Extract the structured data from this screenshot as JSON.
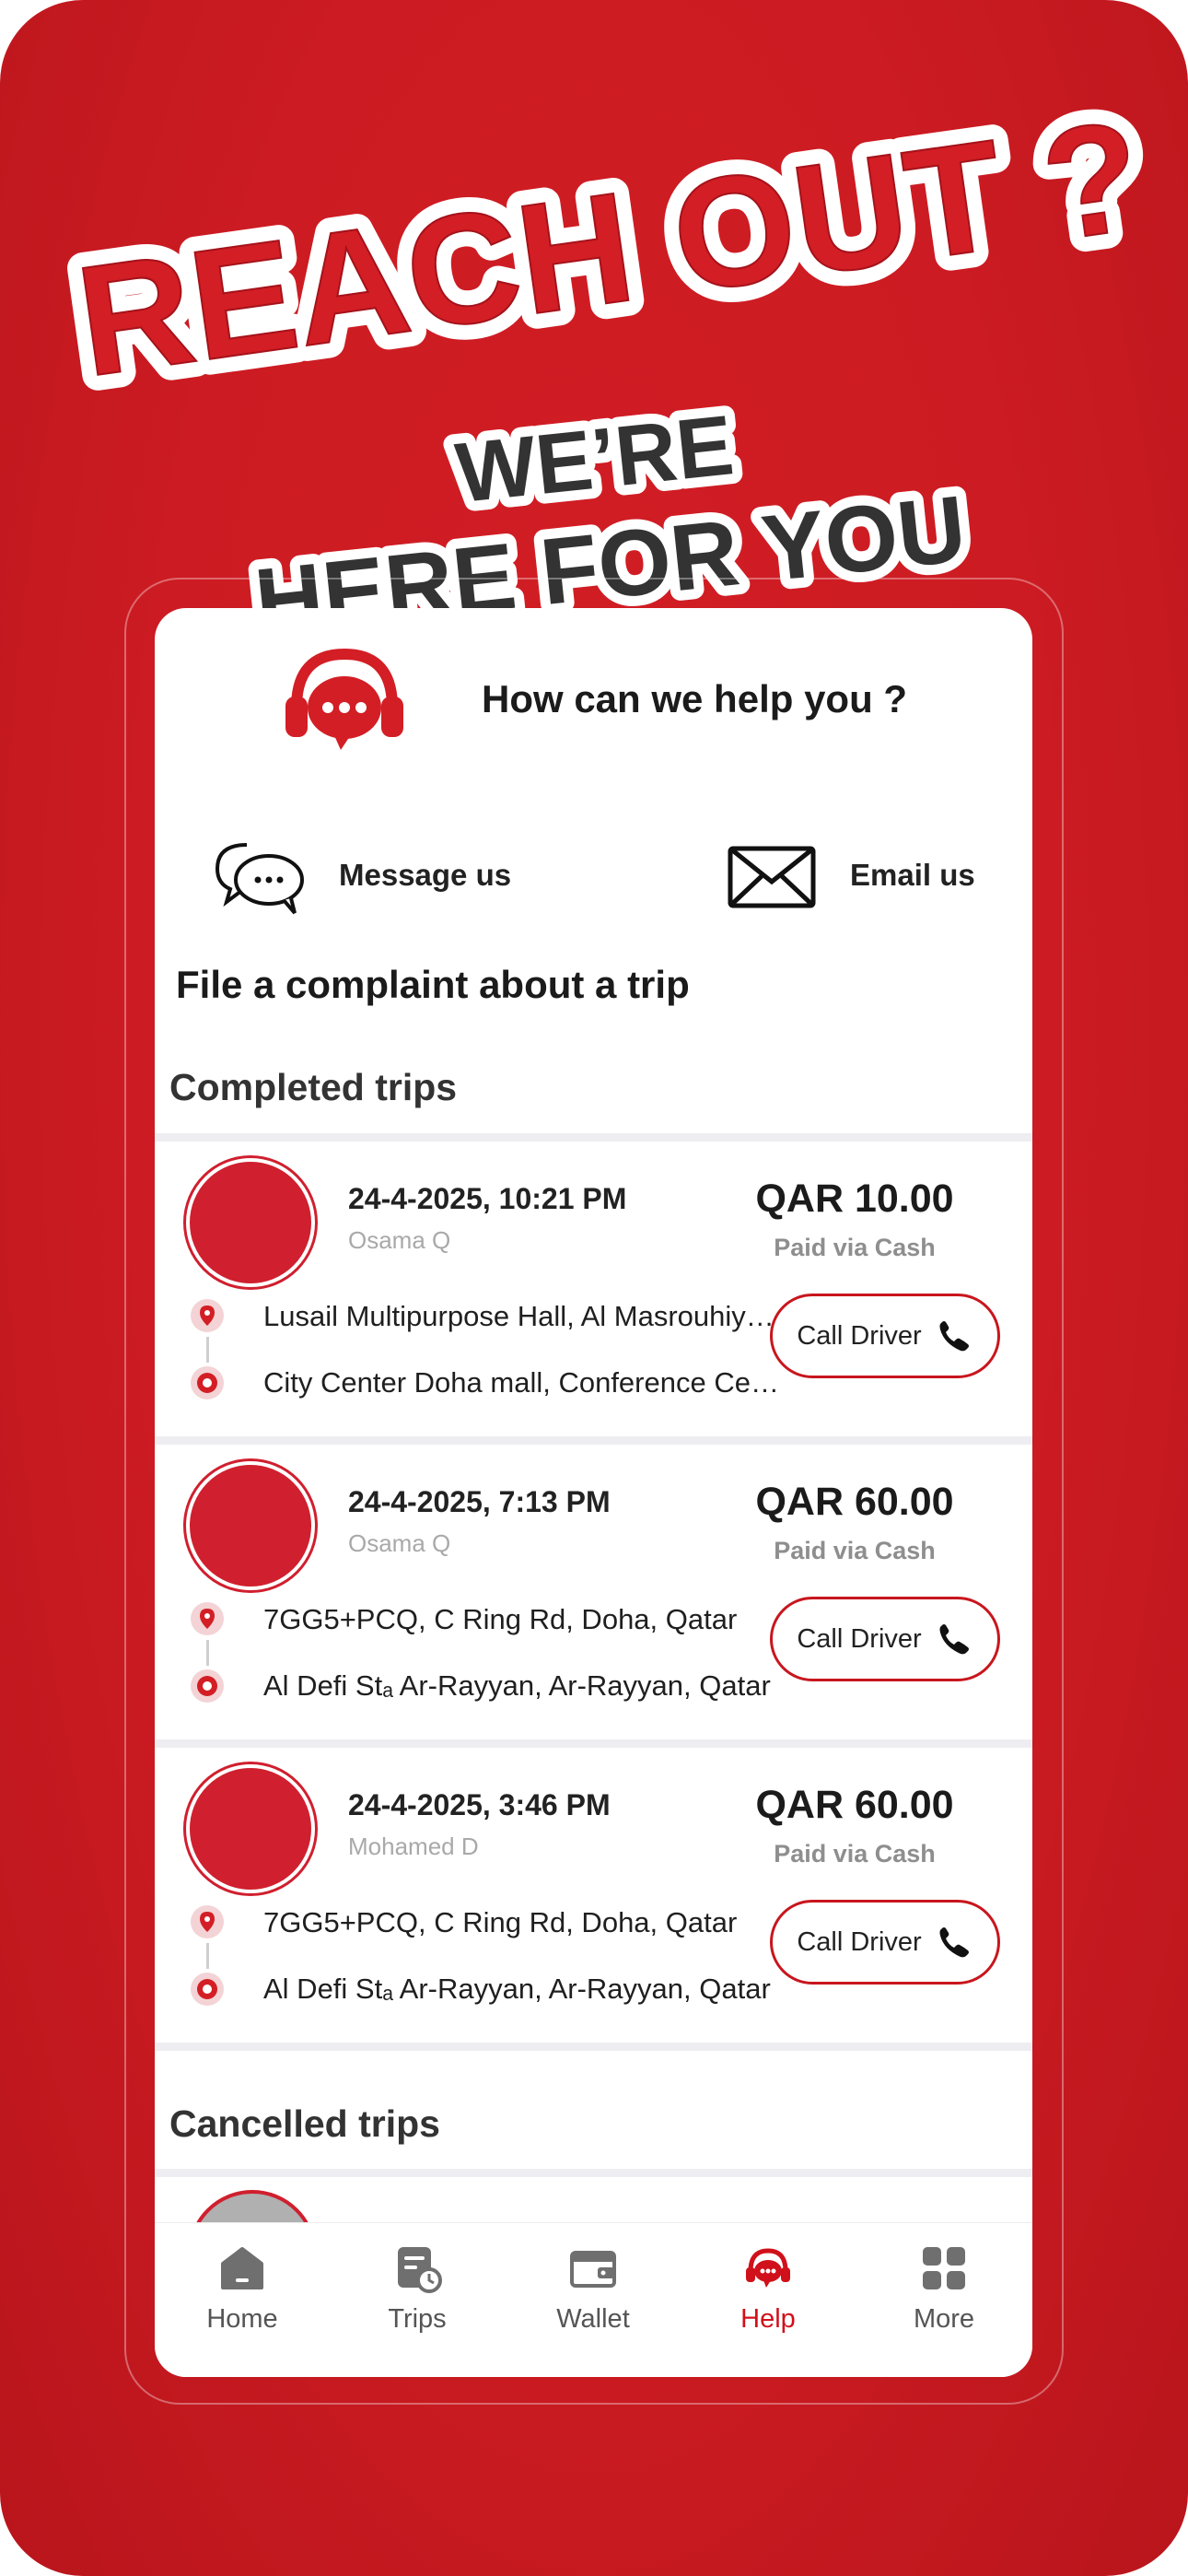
{
  "headline": {
    "line1": "REACH OUT ?",
    "line2": "WE’RE",
    "line3": "HERE FOR YOU"
  },
  "help": {
    "title": "How can we help you ?",
    "icon": "headset-chat-icon"
  },
  "contact": {
    "message_label": "Message us",
    "message_icon": "chat-bubbles-icon",
    "email_label": "Email us",
    "email_icon": "envelope-icon"
  },
  "complaint_title": "File a complaint about a trip",
  "sections": {
    "completed": "Completed trips",
    "cancelled": "Cancelled trips"
  },
  "trips": [
    {
      "date": "24-4-2025, 10:21 PM",
      "driver": "Osama Q",
      "price": "QAR 10.00",
      "paid": "Paid via Cash",
      "from": "Lusail Multipurpose Hall, Al Masrouhiya, Lusail, Qatar",
      "to": "City Center Doha mall, Conference Centre St, Doha, Qatar",
      "button": "Call Driver"
    },
    {
      "date": "24-4-2025, 7:13 PM",
      "driver": "Osama Q",
      "price": "QAR 60.00",
      "paid": "Paid via Cash",
      "from": "7GG5+PCQ, C Ring Rd, Doha, Qatar",
      "to": "Al Defi Stₐ Ar-Rayyan, Ar-Rayyan, Qatar",
      "button": "Call Driver"
    },
    {
      "date": "24-4-2025, 3:46 PM",
      "driver": "Mohamed D",
      "price": "QAR 60.00",
      "paid": "Paid via Cash",
      "from": "7GG5+PCQ, C Ring Rd, Doha, Qatar",
      "to": "Al Defi Stₐ Ar-Rayyan, Ar-Rayyan, Qatar",
      "button": "Call Driver"
    }
  ],
  "tabs": [
    {
      "label": "Home",
      "icon": "home-icon"
    },
    {
      "label": "Trips",
      "icon": "trips-clock-icon"
    },
    {
      "label": "Wallet",
      "icon": "wallet-icon"
    },
    {
      "label": "Help",
      "icon": "help-headset-icon",
      "active": true
    },
    {
      "label": "More",
      "icon": "grid-icon"
    }
  ],
  "colors": {
    "brand_red": "#d31e25",
    "avatar_red": "#d01f2e",
    "active_tab": "#d0101a"
  }
}
